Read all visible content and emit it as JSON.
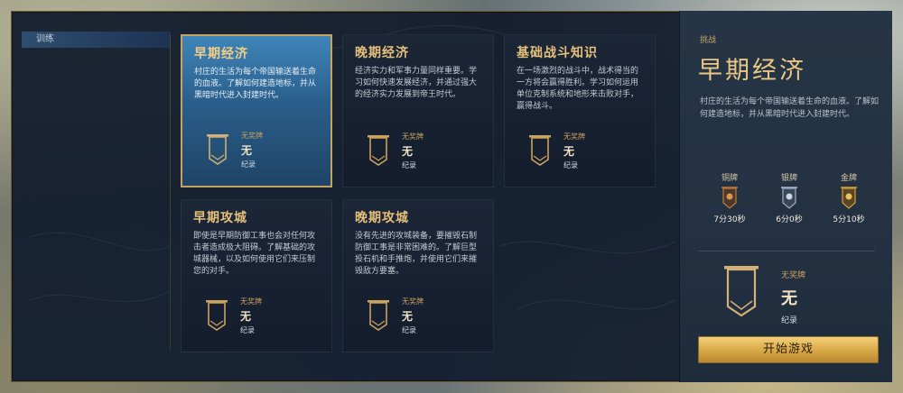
{
  "nav": {
    "items": [
      {
        "label": "训练"
      }
    ]
  },
  "cards": [
    {
      "title": "早期经济",
      "desc": "村庄的生活为每个帝国输送着生命的血液。了解如何建造地标，并从黑暗时代进入封建时代。",
      "medal_status": "无奖牌",
      "medal_value": "无",
      "record_label": "纪录",
      "selected": true
    },
    {
      "title": "晚期经济",
      "desc": "经济实力和军事力量同样重要。学习如何快速发展经济，并通过强大的经济实力发展到帝王时代。",
      "medal_status": "无奖牌",
      "medal_value": "无",
      "record_label": "纪录",
      "selected": false
    },
    {
      "title": "基础战斗知识",
      "desc": "在一场激烈的战斗中，战术得当的一方将会赢得胜利。学习如何运用单位克制系统和地形来击败对手，赢得战斗。",
      "medal_status": "无奖牌",
      "medal_value": "无",
      "record_label": "纪录",
      "selected": false
    },
    {
      "title": "早期攻城",
      "desc": "即使是早期防御工事也会对任何攻击者造成极大阻碍。了解基础的攻城器械，以及如何使用它们来压制您的对手。",
      "medal_status": "无奖牌",
      "medal_value": "无",
      "record_label": "纪录",
      "selected": false
    },
    {
      "title": "晚期攻城",
      "desc": "没有先进的攻城装备，要摧毁石制防御工事是非常困难的。了解巨型投石机和手推炮，并使用它们来摧毁敌方要塞。",
      "medal_status": "无奖牌",
      "medal_value": "无",
      "record_label": "纪录",
      "selected": false
    }
  ],
  "panel": {
    "label": "挑战",
    "title": "早期经济",
    "desc": "村庄的生活为每个帝国输送着生命的血液。了解如何建造地标，并从黑暗时代进入封建时代。",
    "medals": [
      {
        "name": "铜牌",
        "time": "7分30秒",
        "icon": "bronze-medal-icon",
        "color": "#c37a3c"
      },
      {
        "name": "银牌",
        "time": "6分0秒",
        "icon": "silver-medal-icon",
        "color": "#9fb1c6"
      },
      {
        "name": "金牌",
        "time": "5分10秒",
        "icon": "gold-medal-icon",
        "color": "#d7a13d"
      }
    ],
    "status": "无奖牌",
    "value": "无",
    "record_label": "纪录"
  },
  "start_button": {
    "label": "开始游戏"
  },
  "colors": {
    "accent_gold": "#e6c07a",
    "selected_card": "#2a5e8a",
    "button_gold": "#d7a745"
  }
}
